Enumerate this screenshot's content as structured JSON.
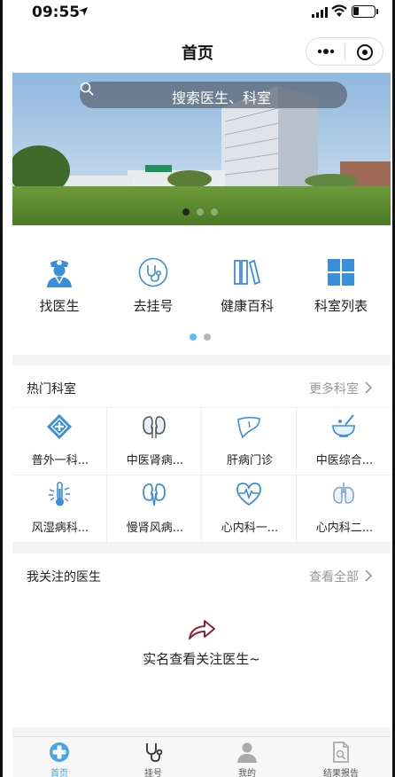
{
  "status_bar": {
    "time": "09:55"
  },
  "nav": {
    "title": "首页"
  },
  "banner": {
    "search_placeholder": "搜索医生、科室"
  },
  "quick_menu": {
    "items": [
      {
        "label": "找医生",
        "icon": "doctor-icon"
      },
      {
        "label": "去挂号",
        "icon": "stethoscope-icon"
      },
      {
        "label": "健康百科",
        "icon": "books-icon"
      },
      {
        "label": "科室列表",
        "icon": "grid-icon"
      }
    ]
  },
  "hot_departments": {
    "title": "热门科室",
    "more": "更多科室",
    "items": [
      {
        "label": "普外一科...",
        "icon": "plus-diamond-icon"
      },
      {
        "label": "中医肾病...",
        "icon": "kidney-icon"
      },
      {
        "label": "肝病门诊",
        "icon": "liver-icon"
      },
      {
        "label": "中医综合...",
        "icon": "mortar-icon"
      },
      {
        "label": "风湿病科...",
        "icon": "thermometer-icon"
      },
      {
        "label": "慢肾风病...",
        "icon": "kidney-outline-icon"
      },
      {
        "label": "心内科一...",
        "icon": "heart-pulse-icon"
      },
      {
        "label": "心内科二...",
        "icon": "lungs-icon"
      }
    ]
  },
  "followed_doctors": {
    "title": "我关注的医生",
    "more": "查看全部",
    "empty_text": "实名查看关注医生~"
  },
  "tab_bar": {
    "tabs": [
      {
        "label": "首页",
        "icon": "home-cross-icon",
        "active": true
      },
      {
        "label": "挂号",
        "icon": "stethoscope-icon",
        "active": false
      },
      {
        "label": "我的",
        "icon": "person-icon",
        "active": false
      },
      {
        "label": "结果报告",
        "icon": "report-icon",
        "active": false
      }
    ]
  },
  "colors": {
    "accent": "#4aa3e3",
    "icon_blue": "#3b8fd9",
    "muted": "#999999",
    "empty_icon": "#8b2232"
  }
}
